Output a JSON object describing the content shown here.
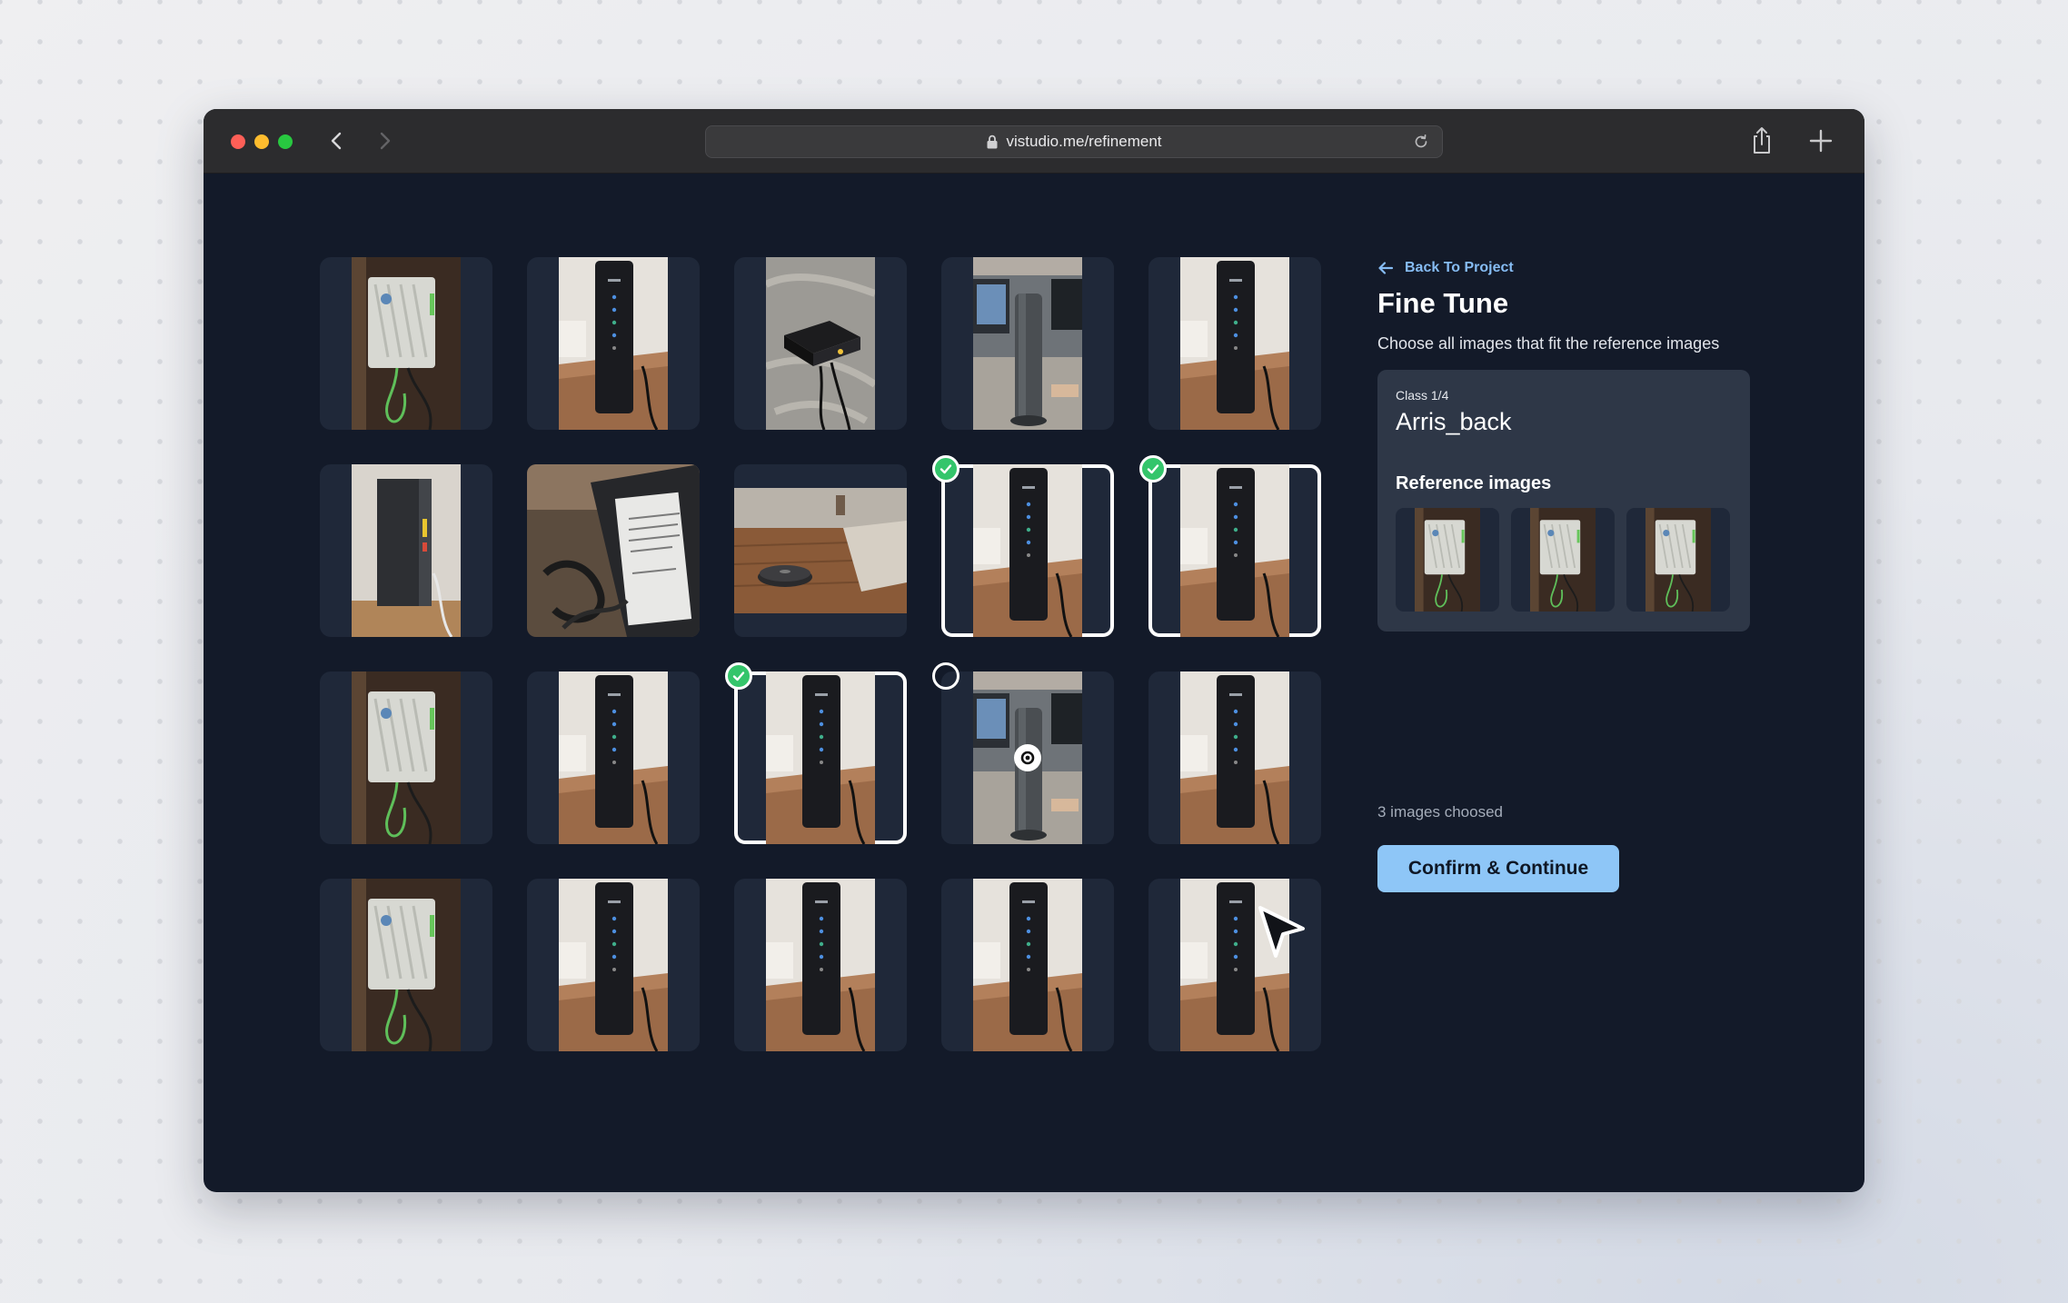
{
  "browser": {
    "url": "vistudio.me/refinement",
    "icons": [
      "lock-icon",
      "reload-icon",
      "share-icon",
      "plus-icon",
      "back-icon",
      "forward-icon"
    ]
  },
  "panel": {
    "back_label": "Back To Project",
    "title": "Fine Tune",
    "subtitle": "Choose all images that fit the reference images",
    "class_count": "Class 1/4",
    "class_name": "Arris_back",
    "reference_title": "Reference images",
    "chosen_text": "3 images choosed",
    "confirm_label": "Confirm & Continue"
  },
  "colors": {
    "background": "#131a29",
    "tile": "#1f2839",
    "card": "#2e3747",
    "accent": "#8ec6f7",
    "check": "#34c56b",
    "link": "#86bcf3"
  },
  "grid": {
    "rows": [
      [
        {
          "image": "white-router-on-wall",
          "state": "none"
        },
        {
          "image": "black-modem-on-desk",
          "state": "none"
        },
        {
          "image": "black-box-on-cloth",
          "state": "none"
        },
        {
          "image": "modem-on-office-desk",
          "state": "none"
        },
        {
          "image": "black-modem-on-desk",
          "state": "none"
        }
      ],
      [
        {
          "image": "modem-side-view",
          "state": "none"
        },
        {
          "image": "modem-label-closeup",
          "state": "none"
        },
        {
          "image": "robot-vacuum-on-floor",
          "state": "none"
        },
        {
          "image": "black-modem-on-desk",
          "state": "selected"
        },
        {
          "image": "black-modem-on-desk",
          "state": "selected"
        }
      ],
      [
        {
          "image": "white-router-on-wall",
          "state": "none"
        },
        {
          "image": "black-modem-on-desk",
          "state": "none"
        },
        {
          "image": "black-modem-on-desk",
          "state": "selected"
        },
        {
          "image": "modem-on-office-desk",
          "state": "hover"
        },
        {
          "image": "black-modem-on-desk",
          "state": "none"
        }
      ],
      [
        {
          "image": "white-router-on-wall",
          "state": "none"
        },
        {
          "image": "black-modem-on-desk",
          "state": "none"
        },
        {
          "image": "black-modem-on-desk",
          "state": "none"
        },
        {
          "image": "black-modem-on-desk",
          "state": "none"
        },
        {
          "image": "black-modem-on-desk",
          "state": "none"
        }
      ]
    ]
  },
  "reference_images": [
    "white-router-on-wall",
    "white-router-on-wall",
    "white-router-on-wall"
  ]
}
